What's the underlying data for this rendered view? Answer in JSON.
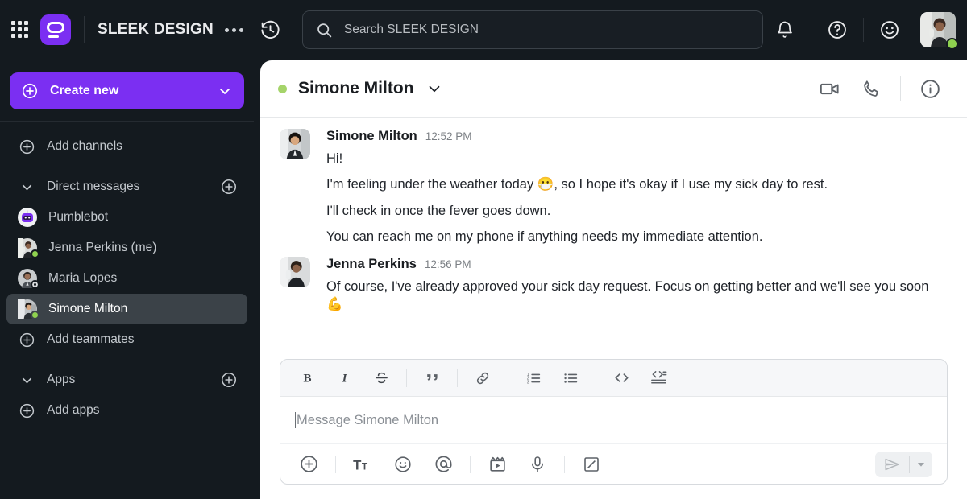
{
  "topbar": {
    "apps_grid_icon": "grid-apps-icon",
    "logo_icon": "pumble-logo-icon",
    "workspace_title": "SLEEK DESIGN",
    "more_icon": "more-horizontal-icon",
    "history_icon": "history-clock-icon",
    "search": {
      "icon": "search-icon",
      "placeholder": "Search SLEEK DESIGN",
      "value": ""
    },
    "notifications_icon": "bell-icon",
    "help_icon": "question-circle-icon",
    "status_icon": "smiley-face-icon",
    "avatar_name": "user-avatar",
    "presence": "online"
  },
  "sidebar": {
    "create_new": {
      "label": "Create new",
      "icon": "plus-circle-icon",
      "chevron": "chevron-down-icon"
    },
    "add_channels": {
      "label": "Add channels",
      "icon": "plus-circle-icon"
    },
    "direct_messages": {
      "label": "Direct messages",
      "chevron": "chevron-down-icon",
      "add_icon": "plus-circle-icon"
    },
    "dm_items": [
      {
        "name": "Pumblebot",
        "status": "none",
        "selected": false,
        "avatar": "pumblebot-avatar"
      },
      {
        "name": "Jenna Perkins (me)",
        "status": "online",
        "selected": false,
        "avatar": "jenna-perkins-avatar"
      },
      {
        "name": "Maria Lopes",
        "status": "away",
        "selected": false,
        "avatar": "maria-lopes-avatar"
      },
      {
        "name": "Simone Milton",
        "status": "online",
        "selected": true,
        "avatar": "simone-milton-avatar"
      }
    ],
    "add_teammates": {
      "label": "Add teammates",
      "icon": "plus-circle-icon"
    },
    "apps": {
      "label": "Apps",
      "chevron": "chevron-down-icon",
      "add_icon": "plus-circle-icon"
    },
    "add_apps": {
      "label": "Add apps",
      "icon": "plus-circle-icon"
    }
  },
  "chat": {
    "header": {
      "presence": "online",
      "title": "Simone Milton",
      "chevron": "chevron-down-icon",
      "video_icon": "video-camera-icon",
      "call_icon": "phone-icon",
      "info_icon": "info-circle-icon"
    },
    "messages": [
      {
        "author": "Simone Milton",
        "time": "12:52 PM",
        "avatar": "simone-milton-avatar",
        "lines": [
          "Hi!",
          "I'm feeling under the weather today 😷, so I hope it's okay if I use my sick day to rest.",
          "I'll check in once the fever goes down.",
          "You can reach me on my phone if anything needs my immediate attention."
        ]
      },
      {
        "author": "Jenna Perkins",
        "time": "12:56 PM",
        "avatar": "jenna-perkins-avatar",
        "lines": [
          "Of course, I've already approved your sick day request. Focus on getting better and we'll see you soon 💪"
        ]
      }
    ],
    "composer": {
      "format_buttons": [
        "bold-icon",
        "italic-icon",
        "strikethrough-icon",
        "blockquote-icon",
        "link-icon",
        "ordered-list-icon",
        "bullet-list-icon",
        "inline-code-icon",
        "code-block-icon"
      ],
      "placeholder": "Message Simone Milton",
      "value": "",
      "action_buttons": [
        "attach-plus-icon",
        "text-format-icon",
        "emoji-icon",
        "mention-icon",
        "video-clip-icon",
        "microphone-icon",
        "whiteboard-icon"
      ],
      "send_icon": "send-plane-icon",
      "send_options_icon": "chevron-down-icon",
      "send_enabled": false
    }
  },
  "colors": {
    "brand_purple": "#7b2ff2",
    "sidebar_bg": "#141a1f",
    "panel_bg": "#ffffff",
    "online_green": "#8fd14f",
    "selected_row": "#3b4248"
  }
}
